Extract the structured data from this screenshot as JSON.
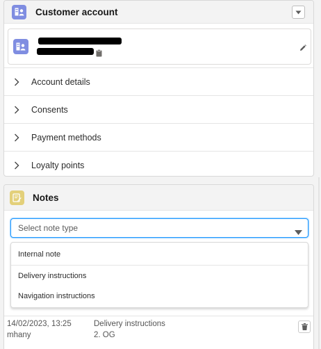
{
  "account_card": {
    "title": "Customer account",
    "icon": "contact-card-icon",
    "icon_color": "#7f8de1",
    "contact": {
      "name_redacted": true,
      "phone_redacted": true,
      "icon": "contact-card-icon",
      "edit_icon": "pencil-icon",
      "copy_icon": "clipboard-icon"
    },
    "sections": [
      {
        "label": "Account details"
      },
      {
        "label": "Consents"
      },
      {
        "label": "Payment methods"
      },
      {
        "label": "Loyalty points"
      }
    ]
  },
  "notes_card": {
    "title": "Notes",
    "icon": "note-icon",
    "icon_color": "#e3d07a",
    "note_type_select": {
      "placeholder": "Select note type",
      "focus_color": "#1b96ff",
      "options": [
        "Internal note",
        "Delivery instructions",
        "Navigation instructions"
      ]
    },
    "entries": [
      {
        "date": "14/02/2023, 13:25",
        "author": "mhany",
        "type": "Delivery instructions",
        "text": "2. OG"
      }
    ]
  }
}
